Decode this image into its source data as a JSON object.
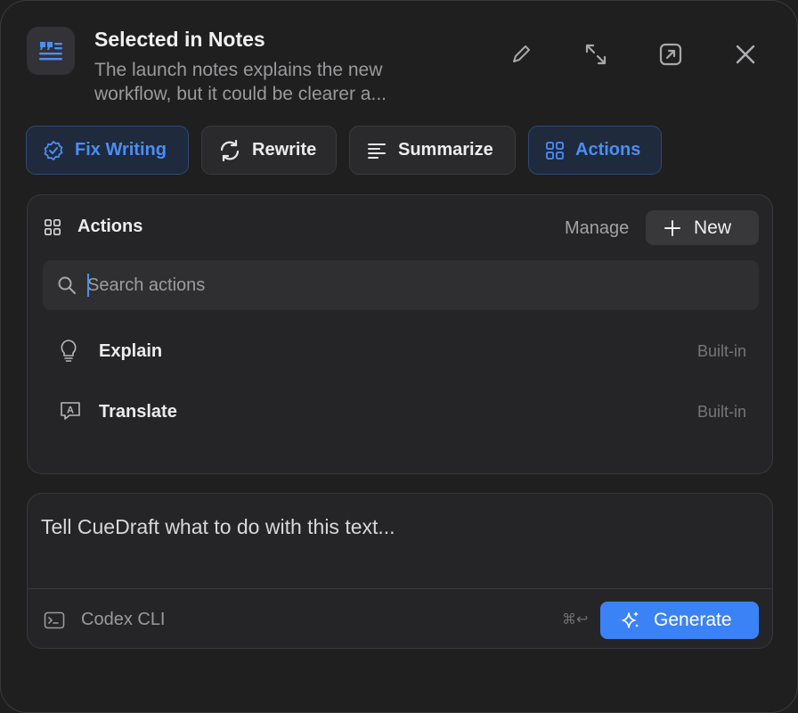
{
  "header": {
    "title": "Selected in Notes",
    "subtitle": "The launch notes explains the new workflow, but it could be clearer a..."
  },
  "tabs": [
    {
      "label": "Fix Writing",
      "icon": "badge-check-icon",
      "active": true
    },
    {
      "label": "Rewrite",
      "icon": "refresh-icon",
      "active": false
    },
    {
      "label": "Summarize",
      "icon": "text-lines-icon",
      "active": false
    },
    {
      "label": "Actions",
      "icon": "grid-icon",
      "active": true
    }
  ],
  "actions_panel": {
    "title": "Actions",
    "manage_label": "Manage",
    "new_label": "New",
    "search_placeholder": "Search actions",
    "items": [
      {
        "label": "Explain",
        "icon": "lightbulb-icon",
        "badge": "Built-in"
      },
      {
        "label": "Translate",
        "icon": "translate-icon",
        "badge": "Built-in"
      }
    ]
  },
  "composer": {
    "placeholder": "Tell CueDraft what to do with this text...",
    "model": "Codex CLI",
    "shortcut": "⌘↩",
    "generate_label": "Generate"
  },
  "colors": {
    "accent": "#3b82f6",
    "active_text": "#4b8ef4",
    "background": "#1f1f20"
  }
}
